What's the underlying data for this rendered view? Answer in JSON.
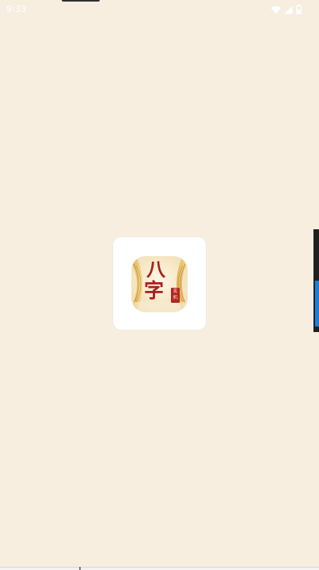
{
  "status_bar": {
    "time": "9:33",
    "icons": [
      "wifi-icon",
      "cellular-signal-icon",
      "battery-icon"
    ]
  },
  "splash": {
    "app_icon_name": "bazi-app-icon",
    "glyph_top": "八",
    "glyph_bottom": "字",
    "seal_text": "玄机"
  },
  "colors": {
    "background": "#f7eee0",
    "card": "#ffffff",
    "glyph_red": "#a4221e",
    "accent_blue": "#1e7fd8"
  }
}
